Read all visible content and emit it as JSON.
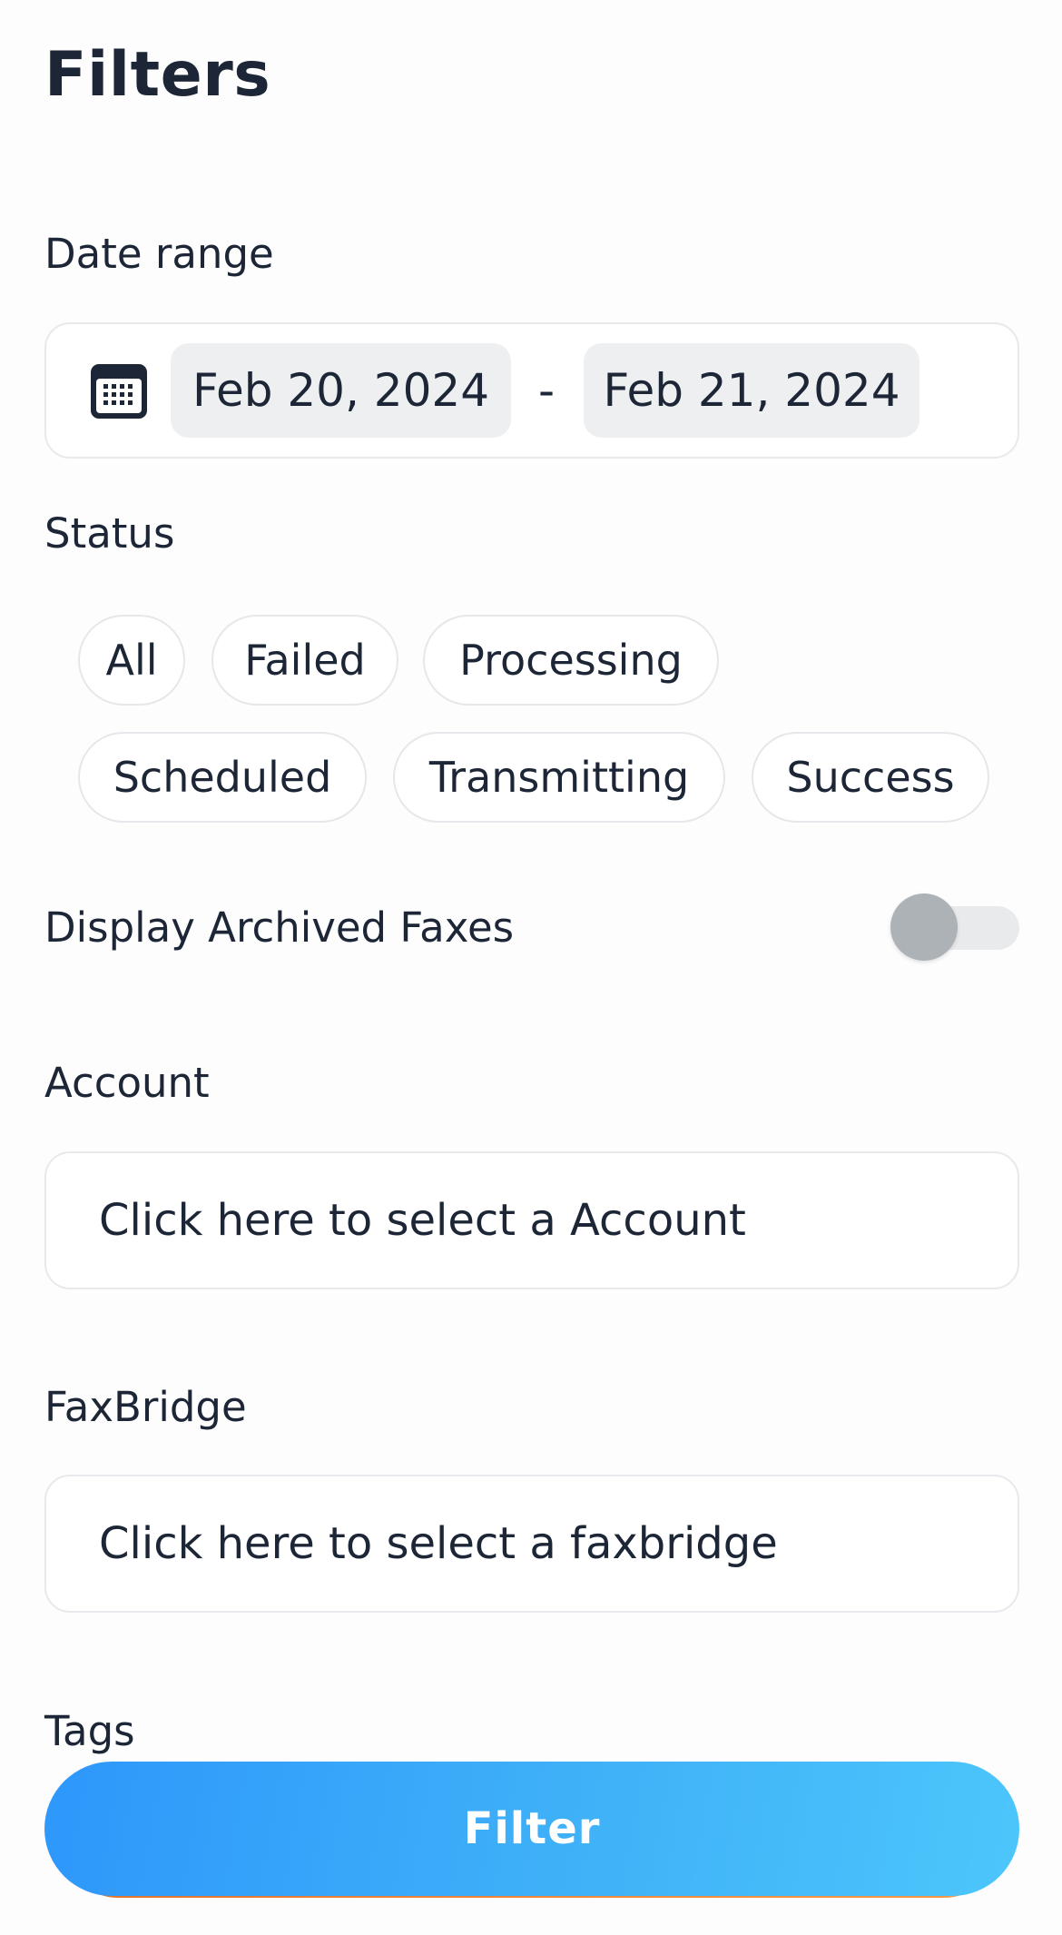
{
  "page": {
    "title": "Filters"
  },
  "date_range": {
    "label": "Date range",
    "start": "Feb 20, 2024",
    "separator": "-",
    "end": "Feb 21, 2024",
    "icon": "calendar-icon"
  },
  "status": {
    "label": "Status",
    "options": [
      "All",
      "Failed",
      "Processing",
      "Scheduled",
      "Transmitting",
      "Success"
    ]
  },
  "archived": {
    "label": "Display Archived Faxes",
    "enabled": false
  },
  "account": {
    "label": "Account",
    "placeholder": "Click here to select a Account"
  },
  "faxbridge": {
    "label": "FaxBridge",
    "placeholder": "Click here to select a faxbridge"
  },
  "tags": {
    "label": "Tags"
  },
  "actions": {
    "filter_label": "Filter"
  },
  "colors": {
    "text": "#1d2636",
    "button_gradient_start": "#2e97fb",
    "button_gradient_end": "#4cc6fb",
    "toggle_off_knob": "#adb2b7"
  }
}
